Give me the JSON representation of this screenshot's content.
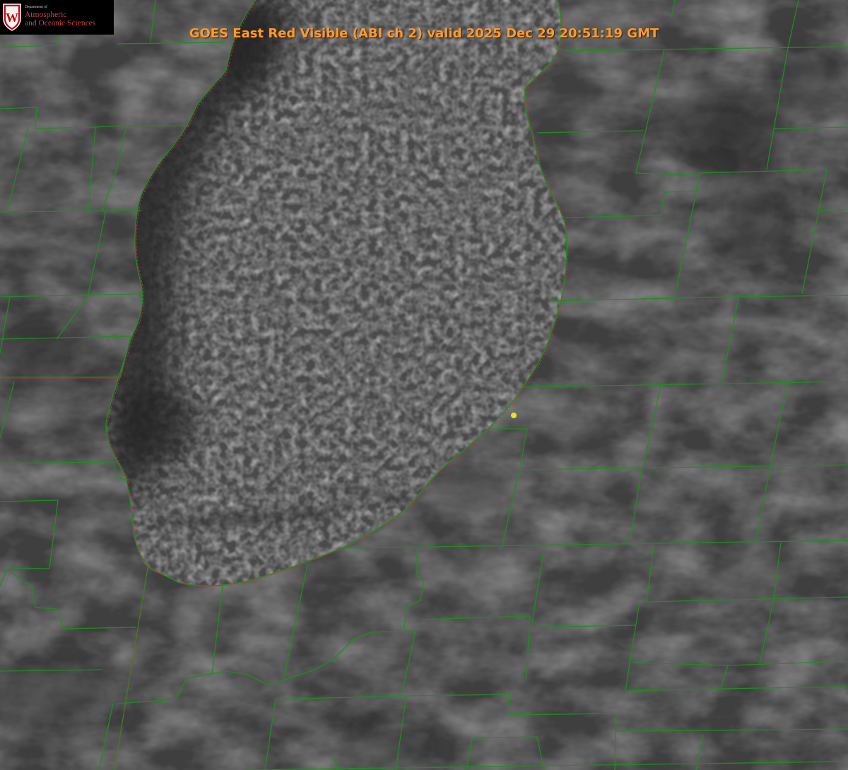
{
  "header": {
    "title": "GOES East Red Visible (ABI ch 2) valid 2025 Dec 29 20:51:19 GMT"
  },
  "logo": {
    "department_line": "Department of",
    "line1": "Atmospheric",
    "line2": "and Oceanic Sciences",
    "shield_letter": "W"
  },
  "map": {
    "boundary_color": "#228b22",
    "shoreline_color": "#c83232",
    "marker_color": "#e6e61e",
    "title_color": "#ff9a2e"
  }
}
